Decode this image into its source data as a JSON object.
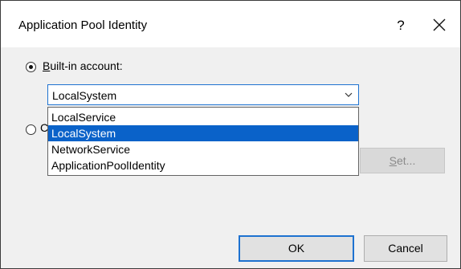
{
  "window": {
    "title": "Application Pool Identity",
    "help_label": "?"
  },
  "identity": {
    "builtin_label_accel": "B",
    "builtin_label_rest": "uilt-in account:",
    "builtin_selected": true,
    "custom_selected": false,
    "custom_label_partial": "C"
  },
  "account_select": {
    "value": "LocalSystem",
    "options": [
      "LocalService",
      "LocalSystem",
      "NetworkService",
      "ApplicationPoolIdentity"
    ],
    "highlighted_option": "LocalSystem"
  },
  "buttons": {
    "set_label_accel": "S",
    "set_label_rest": "et...",
    "ok_label": "OK",
    "cancel_label": "Cancel"
  },
  "colors": {
    "selection": "#0a62c9",
    "focus_border": "#1e72d0"
  }
}
